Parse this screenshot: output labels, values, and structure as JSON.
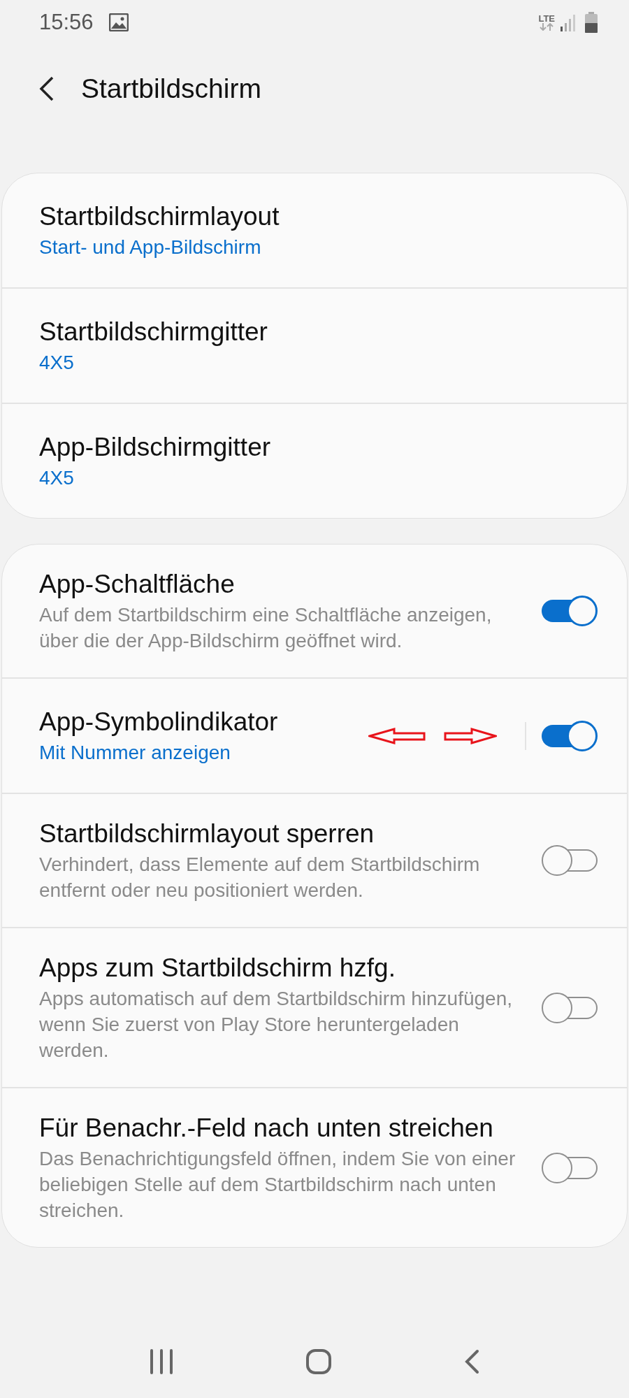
{
  "status_bar": {
    "time": "15:56",
    "network": "LTE"
  },
  "header": {
    "title": "Startbildschirm"
  },
  "groups": [
    {
      "items": [
        {
          "kind": "link",
          "title": "Startbildschirmlayout",
          "value": "Start- und App-Bildschirm"
        },
        {
          "kind": "link",
          "title": "Startbildschirmgitter",
          "value": "4X5"
        },
        {
          "kind": "link",
          "title": "App-Bildschirmgitter",
          "value": "4X5"
        }
      ]
    },
    {
      "items": [
        {
          "kind": "toggle",
          "title": "App-Schaltfläche",
          "description": "Auf dem Startbildschirm eine Schaltfläche anzeigen, über die der App-Bildschirm geöffnet wird.",
          "on": true
        },
        {
          "kind": "split-toggle",
          "title": "App-Symbolindikator",
          "value": "Mit Nummer anzeigen",
          "on": true,
          "arrows": true
        },
        {
          "kind": "toggle",
          "title": "Startbildschirmlayout sperren",
          "description": "Verhindert, dass Elemente auf dem Startbildschirm entfernt oder neu positioniert werden.",
          "on": false
        },
        {
          "kind": "toggle",
          "title": "Apps zum Startbildschirm hzfg.",
          "description": "Apps automatisch auf dem Startbildschirm hinzufügen, wenn Sie zuerst von Play Store heruntergeladen werden.",
          "on": false
        },
        {
          "kind": "toggle",
          "title": "Für Benachr.-Feld nach unten streichen",
          "description": "Das Benachrichtigungsfeld öffnen, indem Sie von einer beliebigen Stelle auf dem Startbildschirm nach unten streichen.",
          "on": false
        }
      ]
    }
  ]
}
